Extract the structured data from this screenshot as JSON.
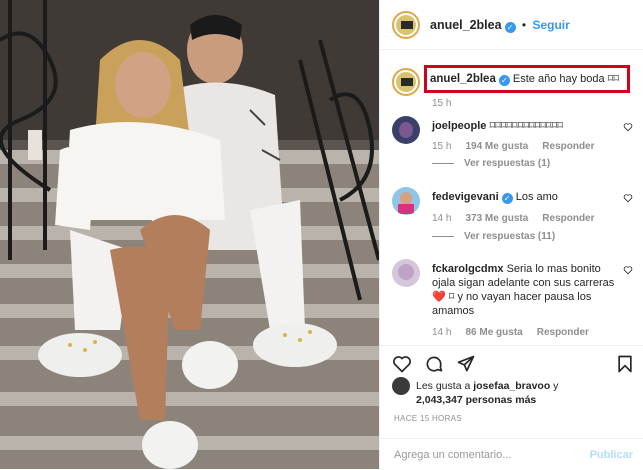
{
  "post": {
    "author": "anuel_2blea",
    "follow_label": "Seguir",
    "separator": "•",
    "caption": "Este año hay boda",
    "caption_symbols": "⌑⌑",
    "caption_time": "15 h"
  },
  "comments": [
    {
      "username": "joelpeople",
      "text": "⌑⌑⌑⌑⌑⌑⌑⌑⌑⌑⌑⌑⌑",
      "time": "15 h",
      "likes": "194 Me gusta",
      "reply": "Responder",
      "view_replies": "Ver respuestas (1)"
    },
    {
      "username": "fedevigevani",
      "text": "Los amo",
      "time": "14 h",
      "likes": "373 Me gusta",
      "reply": "Responder",
      "view_replies": "Ver respuestas (11)"
    },
    {
      "username": "fckarolgcdmx",
      "text": "Seria lo mas bonito ojala sigan adelante con sus carreras❤️ ⌑ y no vayan hacer pausa los amamos",
      "time": "14 h",
      "likes": "86 Me gusta",
      "reply": "Responder"
    }
  ],
  "likes_summary": {
    "prefix": "Les gusta a ",
    "user": "josefaa_bravoo",
    "middle": " y",
    "count": "2,043,347 personas más"
  },
  "time_ago": "HACE 15 HORAS",
  "add_comment": {
    "placeholder": "Agrega un comentario...",
    "publish": "Publicar"
  },
  "icons": {
    "like": "heart-icon",
    "comment": "comment-icon",
    "share": "share-icon",
    "save": "bookmark-icon",
    "more": "more-options-icon"
  },
  "colors": {
    "link": "#3897f0",
    "highlight": "#d0021b",
    "muted": "#8e8e8e"
  }
}
